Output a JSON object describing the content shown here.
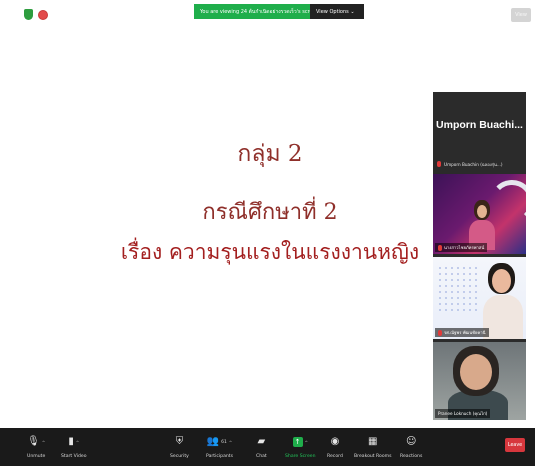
{
  "status": {
    "viewing_banner": "You are viewing 24 ต้นกำเนิดอย่างรวดเร็ว's screen",
    "view_options_label": "View Options ⌄",
    "view_button_label": "View"
  },
  "slide": {
    "line1": "กลุ่ม 2",
    "line2": "กรณีศึกษาที่ 2",
    "line3": "เรื่อง ความรุนแรงในแรงงานหญิง"
  },
  "participants": {
    "header_name": "Umporn Buachi...",
    "host_row": "Umporn Buachin (ฉลองรุ่น...)",
    "tiles": [
      {
        "name": "นางสาวไชยภัทรพาสน์"
      },
      {
        "name": "รศ.ณัฐพร พัฒนชัยคานี"
      },
      {
        "name": "Pranee Loknuch (คุณไก่)"
      }
    ]
  },
  "toolbar": {
    "unmute": "Unmute",
    "start_video": "Start Video",
    "security": "Security",
    "participants": "Participants",
    "participants_count": "61",
    "chat": "Chat",
    "share_screen": "Share Screen",
    "record": "Record",
    "breakout_rooms": "Breakout Rooms",
    "reactions": "Reactions",
    "leave": "Leave"
  },
  "icons": {
    "unmute": "mic-muted-icon",
    "start_video": "video-off-icon",
    "security": "shield-icon",
    "participants": "people-icon",
    "chat": "chat-bubble-icon",
    "share_screen": "share-arrow-icon",
    "record": "record-dot-icon",
    "breakout_rooms": "grid-icon",
    "reactions": "smiley-plus-icon"
  },
  "colors": {
    "slide_text": "#9b2b2b",
    "banner_green": "#1fae4b",
    "leave_red": "#d7373d",
    "toolbar_bg": "#1a1a1a"
  }
}
